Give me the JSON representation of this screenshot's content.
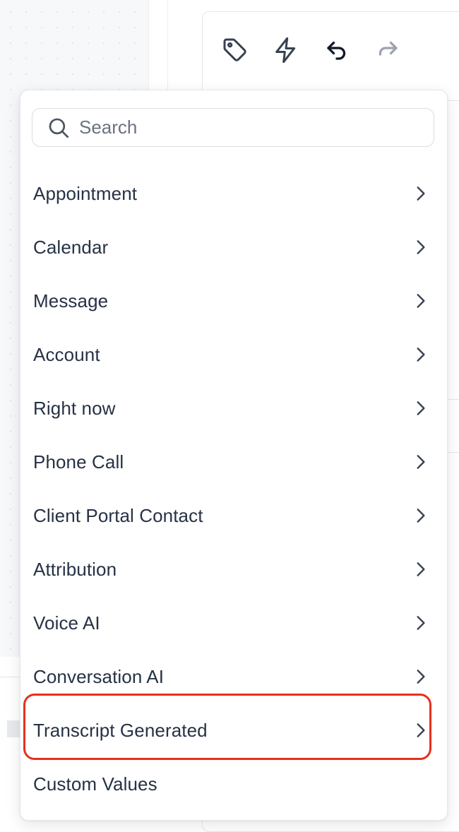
{
  "toolbar": {
    "buttons": [
      {
        "name": "tag-icon",
        "label": "Tag"
      },
      {
        "name": "lightning-icon",
        "label": "Action"
      },
      {
        "name": "undo-icon",
        "label": "Undo"
      },
      {
        "name": "redo-icon",
        "label": "Redo"
      }
    ]
  },
  "dropdown": {
    "search": {
      "placeholder": "Search",
      "value": ""
    },
    "items": [
      {
        "label": "Appointment",
        "has_submenu": true
      },
      {
        "label": "Calendar",
        "has_submenu": true
      },
      {
        "label": "Message",
        "has_submenu": true
      },
      {
        "label": "Account",
        "has_submenu": true
      },
      {
        "label": "Right now",
        "has_submenu": true
      },
      {
        "label": "Phone Call",
        "has_submenu": true
      },
      {
        "label": "Client Portal Contact",
        "has_submenu": true
      },
      {
        "label": "Attribution",
        "has_submenu": true
      },
      {
        "label": "Voice AI",
        "has_submenu": true
      },
      {
        "label": "Conversation AI",
        "has_submenu": true
      },
      {
        "label": "Transcript Generated",
        "has_submenu": true,
        "highlighted": true
      },
      {
        "label": "Custom Values",
        "has_submenu": false
      }
    ]
  },
  "colors": {
    "highlight": "#e5301b",
    "text": "#263244",
    "border": "#e5e7eb",
    "canvas": "#f7f8fa"
  }
}
